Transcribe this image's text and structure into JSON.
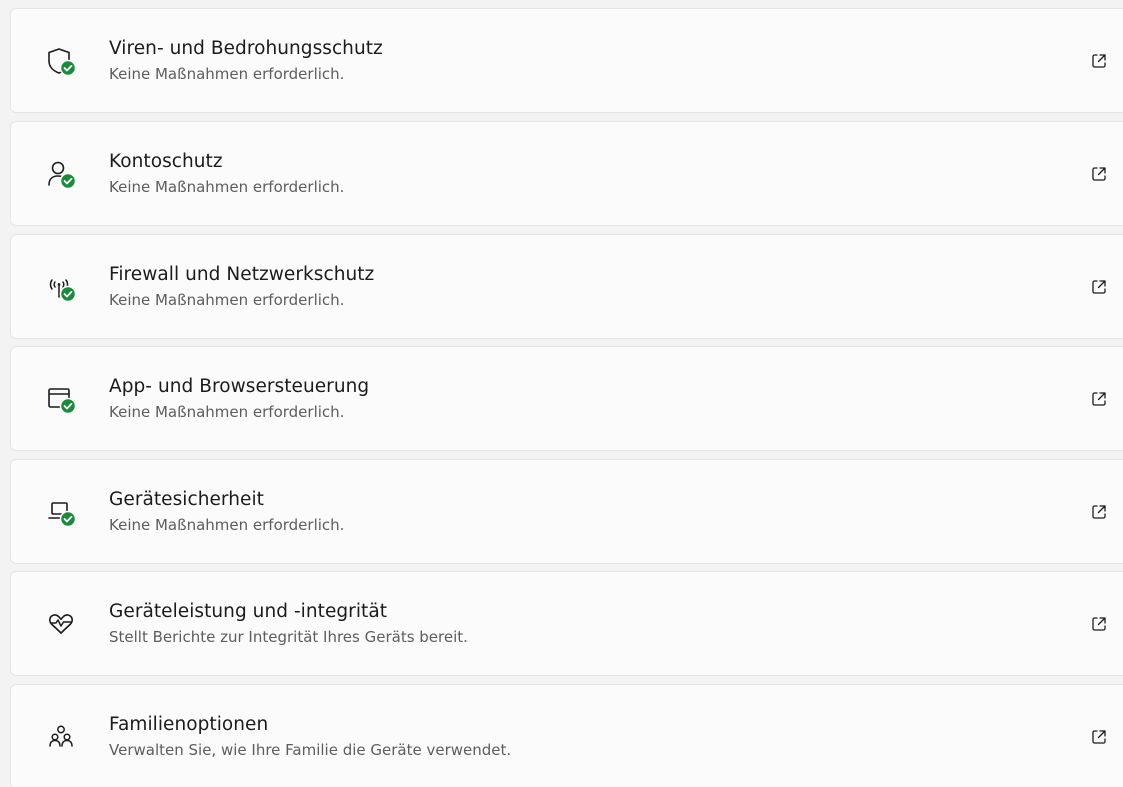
{
  "colors": {
    "check_green": "#1a8a3c",
    "icon_stroke": "#1b1b1b",
    "card_bg": "#fbfbfb",
    "page_bg": "#f3f3f3"
  },
  "items": [
    {
      "icon": "shield-icon",
      "title": "Viren- und Bedrohungsschutz",
      "subtitle": "Keine Maßnahmen erforderlich."
    },
    {
      "icon": "person-icon",
      "title": "Kontoschutz",
      "subtitle": "Keine Maßnahmen erforderlich."
    },
    {
      "icon": "antenna-icon",
      "title": "Firewall und Netzwerkschutz",
      "subtitle": "Keine Maßnahmen erforderlich."
    },
    {
      "icon": "browser-window-icon",
      "title": "App- und Browsersteuerung",
      "subtitle": "Keine Maßnahmen erforderlich."
    },
    {
      "icon": "laptop-icon",
      "title": "Gerätesicherheit",
      "subtitle": "Keine Maßnahmen erforderlich."
    },
    {
      "icon": "heart-pulse-icon",
      "title": "Geräteleistung und -integrität",
      "subtitle": "Stellt Berichte zur Integrität Ihres Geräts bereit."
    },
    {
      "icon": "family-icon",
      "title": "Familienoptionen",
      "subtitle": "Verwalten Sie, wie Ihre Familie die Geräte verwendet."
    }
  ]
}
